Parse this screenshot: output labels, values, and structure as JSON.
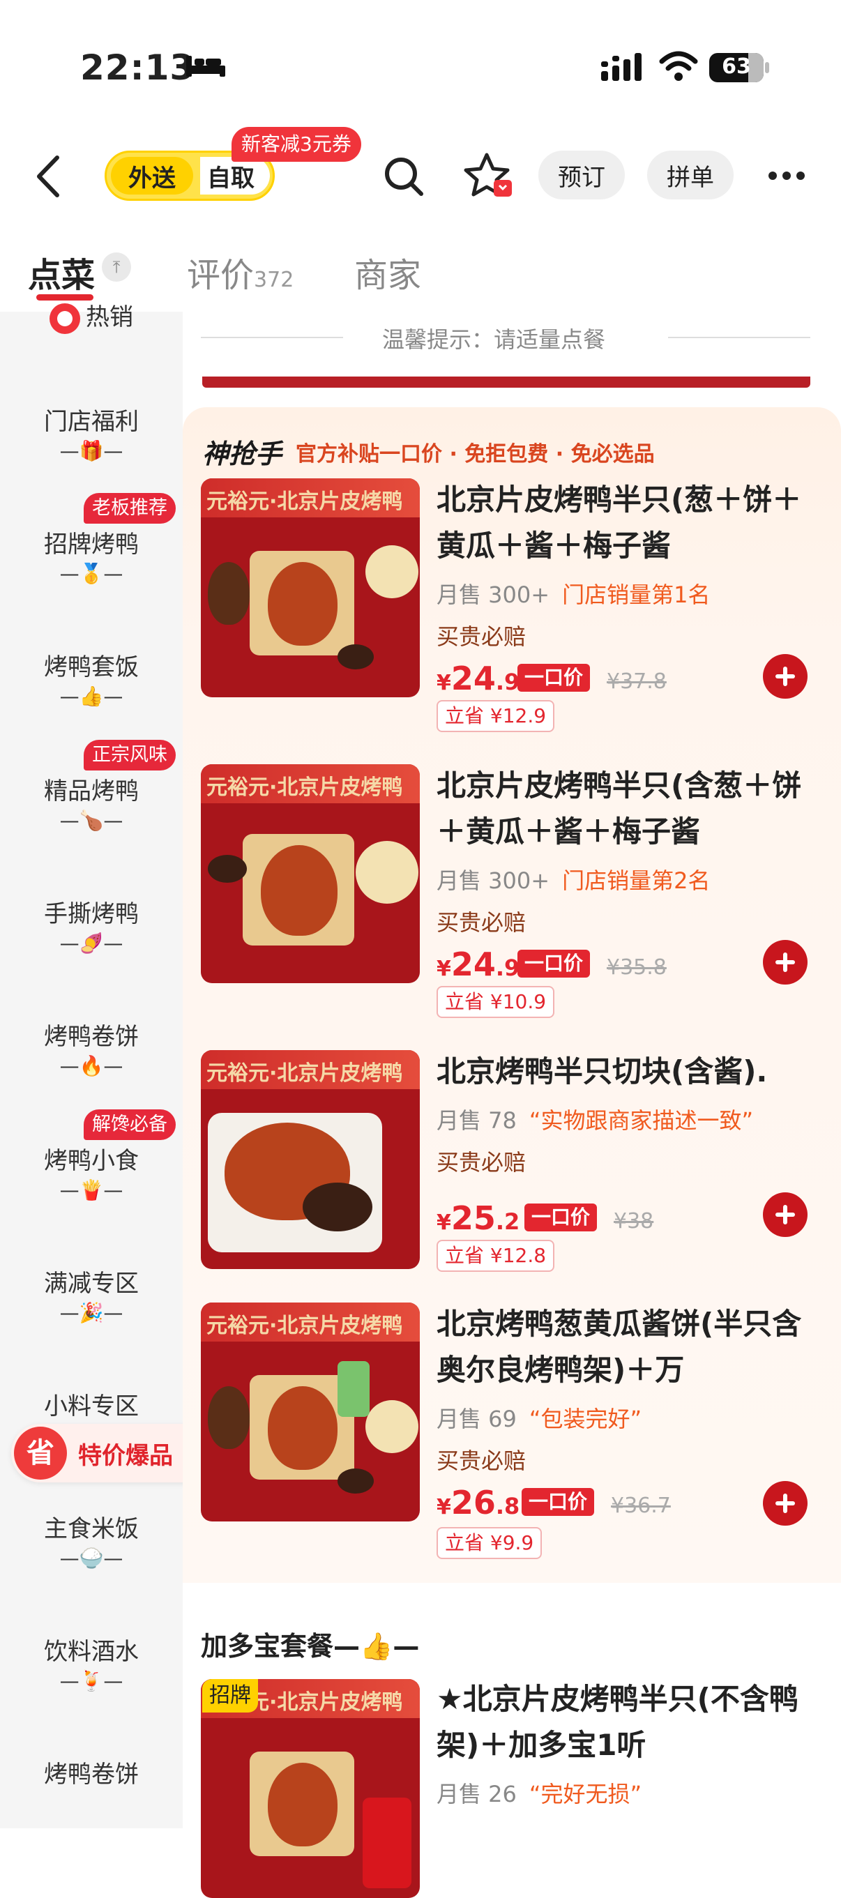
{
  "status": {
    "time": "22:13",
    "battery": "63"
  },
  "nav": {
    "toggle_active": "外送",
    "toggle_other": "自取",
    "coupon_badge": "新客减3元券",
    "reserve": "预订",
    "group": "拼单"
  },
  "tabs": [
    {
      "label": "点菜"
    },
    {
      "label": "评价",
      "count": "372"
    },
    {
      "label": "商家"
    }
  ],
  "sidebar": {
    "items": [
      {
        "label": "热销",
        "emoji": ""
      },
      {
        "label": "门店福利",
        "emoji": "—🎁—"
      },
      {
        "label": "招牌烤鸭",
        "emoji": "—🥇—",
        "tag": "老板推荐"
      },
      {
        "label": "烤鸭套饭",
        "emoji": "—👍—"
      },
      {
        "label": "精品烤鸭",
        "emoji": "—🍗—",
        "tag": "正宗风味"
      },
      {
        "label": "手撕烤鸭",
        "emoji": "—🍠—"
      },
      {
        "label": "烤鸭卷饼",
        "emoji": "—🔥—"
      },
      {
        "label": "烤鸭小食",
        "emoji": "—🍟—",
        "tag": "解馋必备"
      },
      {
        "label": "满减专区",
        "emoji": "—🎉—"
      },
      {
        "label": "小料专区",
        "emoji": ""
      },
      {
        "label": "主食米饭",
        "emoji": "—🍚—"
      },
      {
        "label": "饮料酒水",
        "emoji": "—🍹—"
      },
      {
        "label": "烤鸭卷饼",
        "emoji": ""
      }
    ],
    "promo": {
      "icon": "省",
      "label": "特价爆品",
      "arrow": "›"
    }
  },
  "main": {
    "tip": "温馨提示：请适量点餐",
    "promo_section": {
      "logo": "神抢手",
      "subtitle": "官方补贴一口价 · 免拒包费 · 免必选品"
    },
    "items": [
      {
        "name": "北京片皮烤鸭半只(葱＋饼＋黄瓜＋酱＋梅子酱",
        "sales": "月售 300+",
        "extra": "门店销量第1名",
        "guarantee": "买贵必赔",
        "price_int": "24",
        "price_dec": ".9",
        "price_tag": "一口价",
        "original": "¥37.8",
        "save": "立省 ¥12.9"
      },
      {
        "name": "北京片皮烤鸭半只(含葱＋饼＋黄瓜＋酱＋梅子酱",
        "sales": "月售 300+",
        "extra": "门店销量第2名",
        "guarantee": "买贵必赔",
        "price_int": "24",
        "price_dec": ".9",
        "price_tag": "一口价",
        "original": "¥35.8",
        "save": "立省 ¥10.9"
      },
      {
        "name": "北京烤鸭半只切块(含酱).",
        "sales": "月售 78",
        "extra": "“实物跟商家描述一致”",
        "guarantee": "买贵必赔",
        "price_int": "25",
        "price_dec": ".2",
        "price_tag": "一口价",
        "original": "¥38",
        "save": "立省 ¥12.8"
      },
      {
        "name": "北京烤鸭葱黄瓜酱饼(半只含奥尔良烤鸭架)＋万",
        "sales": "月售 69",
        "extra": "“包装完好”",
        "guarantee": "买贵必赔",
        "price_int": "26",
        "price_dec": ".8",
        "price_tag": "一口价",
        "original": "¥36.7",
        "save": "立省 ¥9.9"
      }
    ],
    "section2": {
      "title": "加多宝套餐—👍—",
      "item": {
        "tag": "招牌",
        "name": "★北京片皮烤鸭半只(不含鸭架)＋加多宝1听",
        "sales": "月售 26",
        "extra": "“完好无损”"
      }
    },
    "image_banner_text": "元裕元·北京片皮烤鸭"
  },
  "colors": {
    "accent": "#e3262f",
    "toggle": "#ffd100",
    "panel": "#fff1e6"
  }
}
